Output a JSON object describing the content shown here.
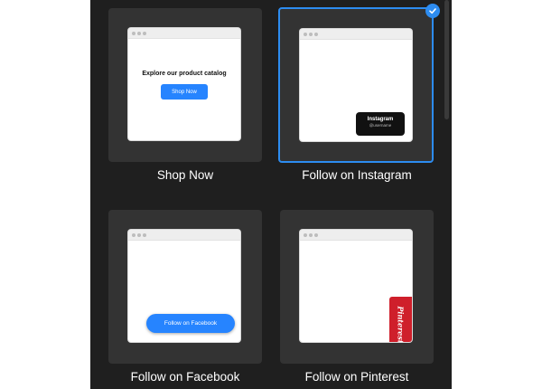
{
  "templates": [
    {
      "label": "Shop Now",
      "selected": false,
      "preview": {
        "heading": "Explore our product catalog",
        "button": "Shop Now"
      }
    },
    {
      "label": "Follow on Instagram",
      "selected": true,
      "preview": {
        "name": "Instagram",
        "handle": "@username"
      }
    },
    {
      "label": "Follow on Facebook",
      "selected": false,
      "preview": {
        "button": "Follow on Facebook"
      }
    },
    {
      "label": "Follow on Pinterest",
      "selected": false,
      "preview": {
        "tab_text": "Pinterest"
      }
    }
  ],
  "colors": {
    "panel_bg": "#1f1f1f",
    "card_bg": "#333333",
    "accent": "#2d8cf0",
    "button_blue": "#2684ff",
    "pinterest_red": "#cf1f2b"
  },
  "icons": {
    "selected_badge": "check-icon"
  }
}
